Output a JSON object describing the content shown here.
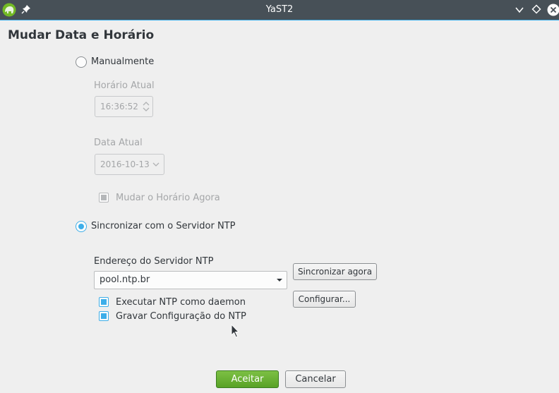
{
  "window": {
    "title": "YaST2"
  },
  "page": {
    "title": "Mudar Data e Horário"
  },
  "manual": {
    "label": "Manualmente",
    "selected": false,
    "time_label": "Horário Atual",
    "time_value": "16:36:52",
    "date_label": "Data Atual",
    "date_value": "2016-10-13",
    "change_now_label": "Mudar o Horário Agora",
    "change_now_checked": true
  },
  "ntp": {
    "label": "Sincronizar com o Servidor NTP",
    "selected": true,
    "server_label": "Endereço do Servidor NTP",
    "server_value": "pool.ntp.br",
    "sync_now_button": "Sincronizar agora",
    "configure_button": "Configurar...",
    "daemon_label": "Executar NTP como daemon",
    "daemon_checked": true,
    "save_label": "Gravar Configuração do NTP",
    "save_checked": true
  },
  "footer": {
    "accept_button": "Aceitar",
    "cancel_button": "Cancelar"
  },
  "colors": {
    "accent": "#3daee9",
    "accept": "#58a226",
    "titlebar": "#475057"
  }
}
